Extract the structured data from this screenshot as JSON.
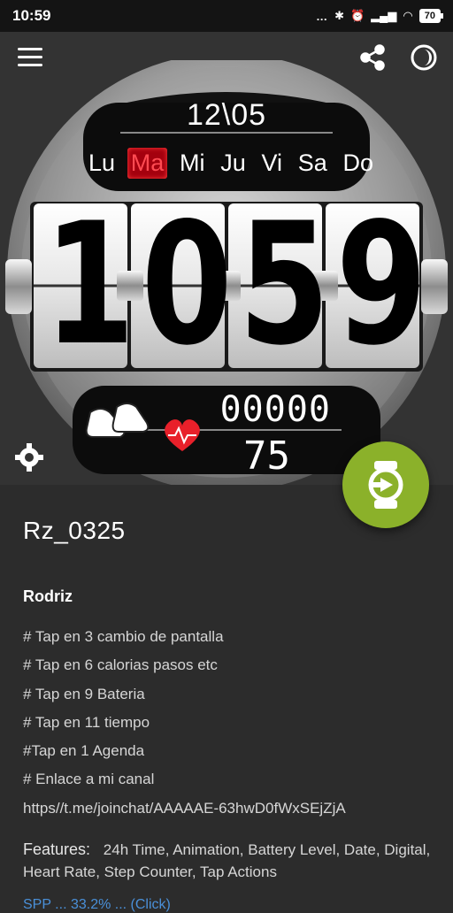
{
  "status_bar": {
    "time": "10:59",
    "battery": "70",
    "more_icon": "…"
  },
  "header": {
    "menu_icon": "hamburger-icon",
    "share_icon": "share-icon",
    "theme_icon": "theme-icon",
    "settings_icon": "gear-icon"
  },
  "watch_face": {
    "date": "12\\05",
    "days": [
      "Lu",
      "Ma",
      "Mi",
      "Ju",
      "Vi",
      "Sa",
      "Do"
    ],
    "active_day": "Ma",
    "hour_digits": [
      "1",
      "0"
    ],
    "minute_digits": [
      "5",
      "9"
    ],
    "steps": "00000",
    "heart_rate": "75"
  },
  "fab": {
    "icon": "send-to-watch-icon",
    "color": "#8bb12a"
  },
  "details": {
    "title": "Rz_0325",
    "author": "Rodriz",
    "description": [
      "# Tap en 3 cambio de pantalla",
      "# Tap en 6 calorias pasos etc",
      "# Tap en 9 Bateria",
      "# Tap en 11 tiempo",
      "#Tap en 1 Agenda",
      "# Enlace a mi canal",
      "https//t.me/joinchat/AAAAAE-63hwD0fWxSEjZjA"
    ],
    "features_label": "Features:",
    "features": "24h Time,  Animation,  Battery Level,  Date,  Digital,  Heart Rate,  Step Counter,  Tap Actions",
    "bottom_partial": "SPP ... 33.2% ... (Click)"
  }
}
